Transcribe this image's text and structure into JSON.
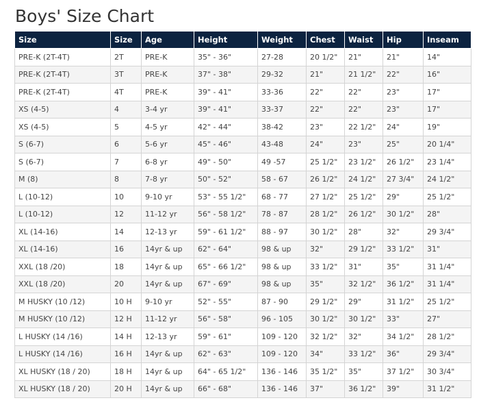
{
  "page": {
    "title": "Boys' Size Chart"
  },
  "table": {
    "headers": [
      "Size",
      "Size",
      "Age",
      "Height",
      "Weight",
      "Chest",
      "Waist",
      "Hip",
      "Inseam"
    ],
    "rows": [
      [
        "PRE-K (2T-4T)",
        "2T",
        "PRE-K",
        "35\" - 36\"",
        "27-28",
        "20 1/2\"",
        "21\"",
        "21\"",
        "14\""
      ],
      [
        "PRE-K (2T-4T)",
        "3T",
        "PRE-K",
        "37\" - 38\"",
        "29-32",
        "21\"",
        "21 1/2\"",
        "22\"",
        "16\""
      ],
      [
        "PRE-K (2T-4T)",
        "4T",
        "PRE-K",
        "39\" - 41\"",
        "33-36",
        "22\"",
        "22\"",
        "23\"",
        "17\""
      ],
      [
        "XS (4-5)",
        "4",
        "3-4 yr",
        "39\" - 41\"",
        "33-37",
        "22\"",
        "22\"",
        "23\"",
        "17\""
      ],
      [
        "XS (4-5)",
        "5",
        "4-5 yr",
        "42\" - 44\"",
        "38-42",
        "23\"",
        "22 1/2\"",
        "24\"",
        "19\""
      ],
      [
        "S (6-7)",
        "6",
        "5-6 yr",
        "45\" - 46\"",
        "43-48",
        "24\"",
        "23\"",
        "25\"",
        "20 1/4\""
      ],
      [
        "S (6-7)",
        "7",
        "6-8 yr",
        "49\" - 50\"",
        "49 -57",
        "25 1/2\"",
        "23 1/2\"",
        "26 1/2\"",
        "23 1/4\""
      ],
      [
        "M (8)",
        "8",
        "7-8 yr",
        "50\" - 52\"",
        "58 - 67",
        "26 1/2\"",
        "24 1/2\"",
        "27 3/4\"",
        "24 1/2\""
      ],
      [
        "L (10-12)",
        "10",
        "9-10 yr",
        "53\" - 55 1/2\"",
        "68 - 77",
        "27 1/2\"",
        "25 1/2\"",
        "29\"",
        "25 1/2\""
      ],
      [
        "L (10-12)",
        "12",
        "11-12 yr",
        "56\" - 58 1/2\"",
        "78 - 87",
        "28 1/2\"",
        "26 1/2\"",
        "30 1/2\"",
        "28\""
      ],
      [
        "XL (14-16)",
        "14",
        "12-13 yr",
        "59\" - 61 1/2\"",
        "88 - 97",
        "30 1/2\"",
        "28\"",
        "32\"",
        "29 3/4\""
      ],
      [
        "XL (14-16)",
        "16",
        "14yr & up",
        "62\" - 64\"",
        "98 & up",
        "32\"",
        "29 1/2\"",
        "33 1/2\"",
        "31\""
      ],
      [
        "XXL (18 /20)",
        "18",
        "14yr & up",
        "65\" - 66 1/2\"",
        "98 & up",
        "33 1/2\"",
        "31\"",
        "35\"",
        "31 1/4\""
      ],
      [
        "XXL (18 /20)",
        "20",
        "14yr & up",
        "67\" - 69\"",
        "98 & up",
        "35\"",
        "32 1/2\"",
        "36 1/2\"",
        "31 1/4\""
      ],
      [
        "M HUSKY (10 /12)",
        "10 H",
        "9-10 yr",
        "52\" - 55\"",
        "87 - 90",
        "29 1/2\"",
        "29\"",
        "31 1/2\"",
        "25 1/2\""
      ],
      [
        "M HUSKY (10 /12)",
        "12 H",
        "11-12 yr",
        "56\" - 58\"",
        "96 - 105",
        "30 1/2\"",
        "30 1/2\"",
        "33\"",
        "27\""
      ],
      [
        "L HUSKY (14 /16)",
        "14 H",
        "12-13 yr",
        "59\" - 61\"",
        "109 - 120",
        "32 1/2\"",
        "32\"",
        "34 1/2\"",
        "28 1/2\""
      ],
      [
        "L HUSKY (14 /16)",
        "16 H",
        "14yr & up",
        "62\" - 63\"",
        "109 - 120",
        "34\"",
        "33 1/2\"",
        "36\"",
        "29 3/4\""
      ],
      [
        "XL HUSKY (18 / 20)",
        "18 H",
        "14yr & up",
        "64\" - 65 1/2\"",
        "136 - 146",
        "35 1/2\"",
        "35\"",
        "37 1/2\"",
        "30 3/4\""
      ],
      [
        "XL HUSKY (18 / 20)",
        "20 H",
        "14yr & up",
        "66\" - 68\"",
        "136 - 146",
        "37\"",
        "36 1/2\"",
        "39\"",
        "31 1/2\""
      ]
    ]
  },
  "colors": {
    "header_bg": "#0c2340",
    "header_text": "#ffffff",
    "stripe_bg": "#f4f4f4",
    "border": "#d4d4d4"
  }
}
